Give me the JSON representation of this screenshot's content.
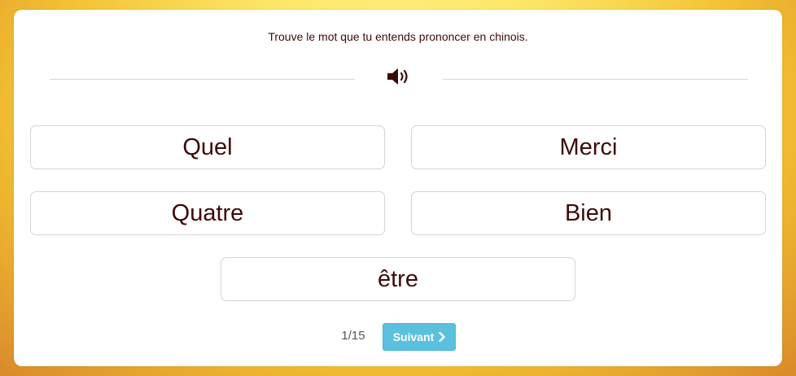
{
  "quiz": {
    "instruction": "Trouve le mot que tu entends prononcer en chinois.",
    "audio_icon": "speaker-volume-icon",
    "choices": [
      "Quel",
      "Merci",
      "Quatre",
      "Bien",
      "être"
    ],
    "progress": "1/15",
    "next_label": "Suivant",
    "next_icon": "chevron-right-icon"
  },
  "colors": {
    "text": "#3d0a0a",
    "next_button": "#5bc0de",
    "border": "#d4d4d4"
  }
}
